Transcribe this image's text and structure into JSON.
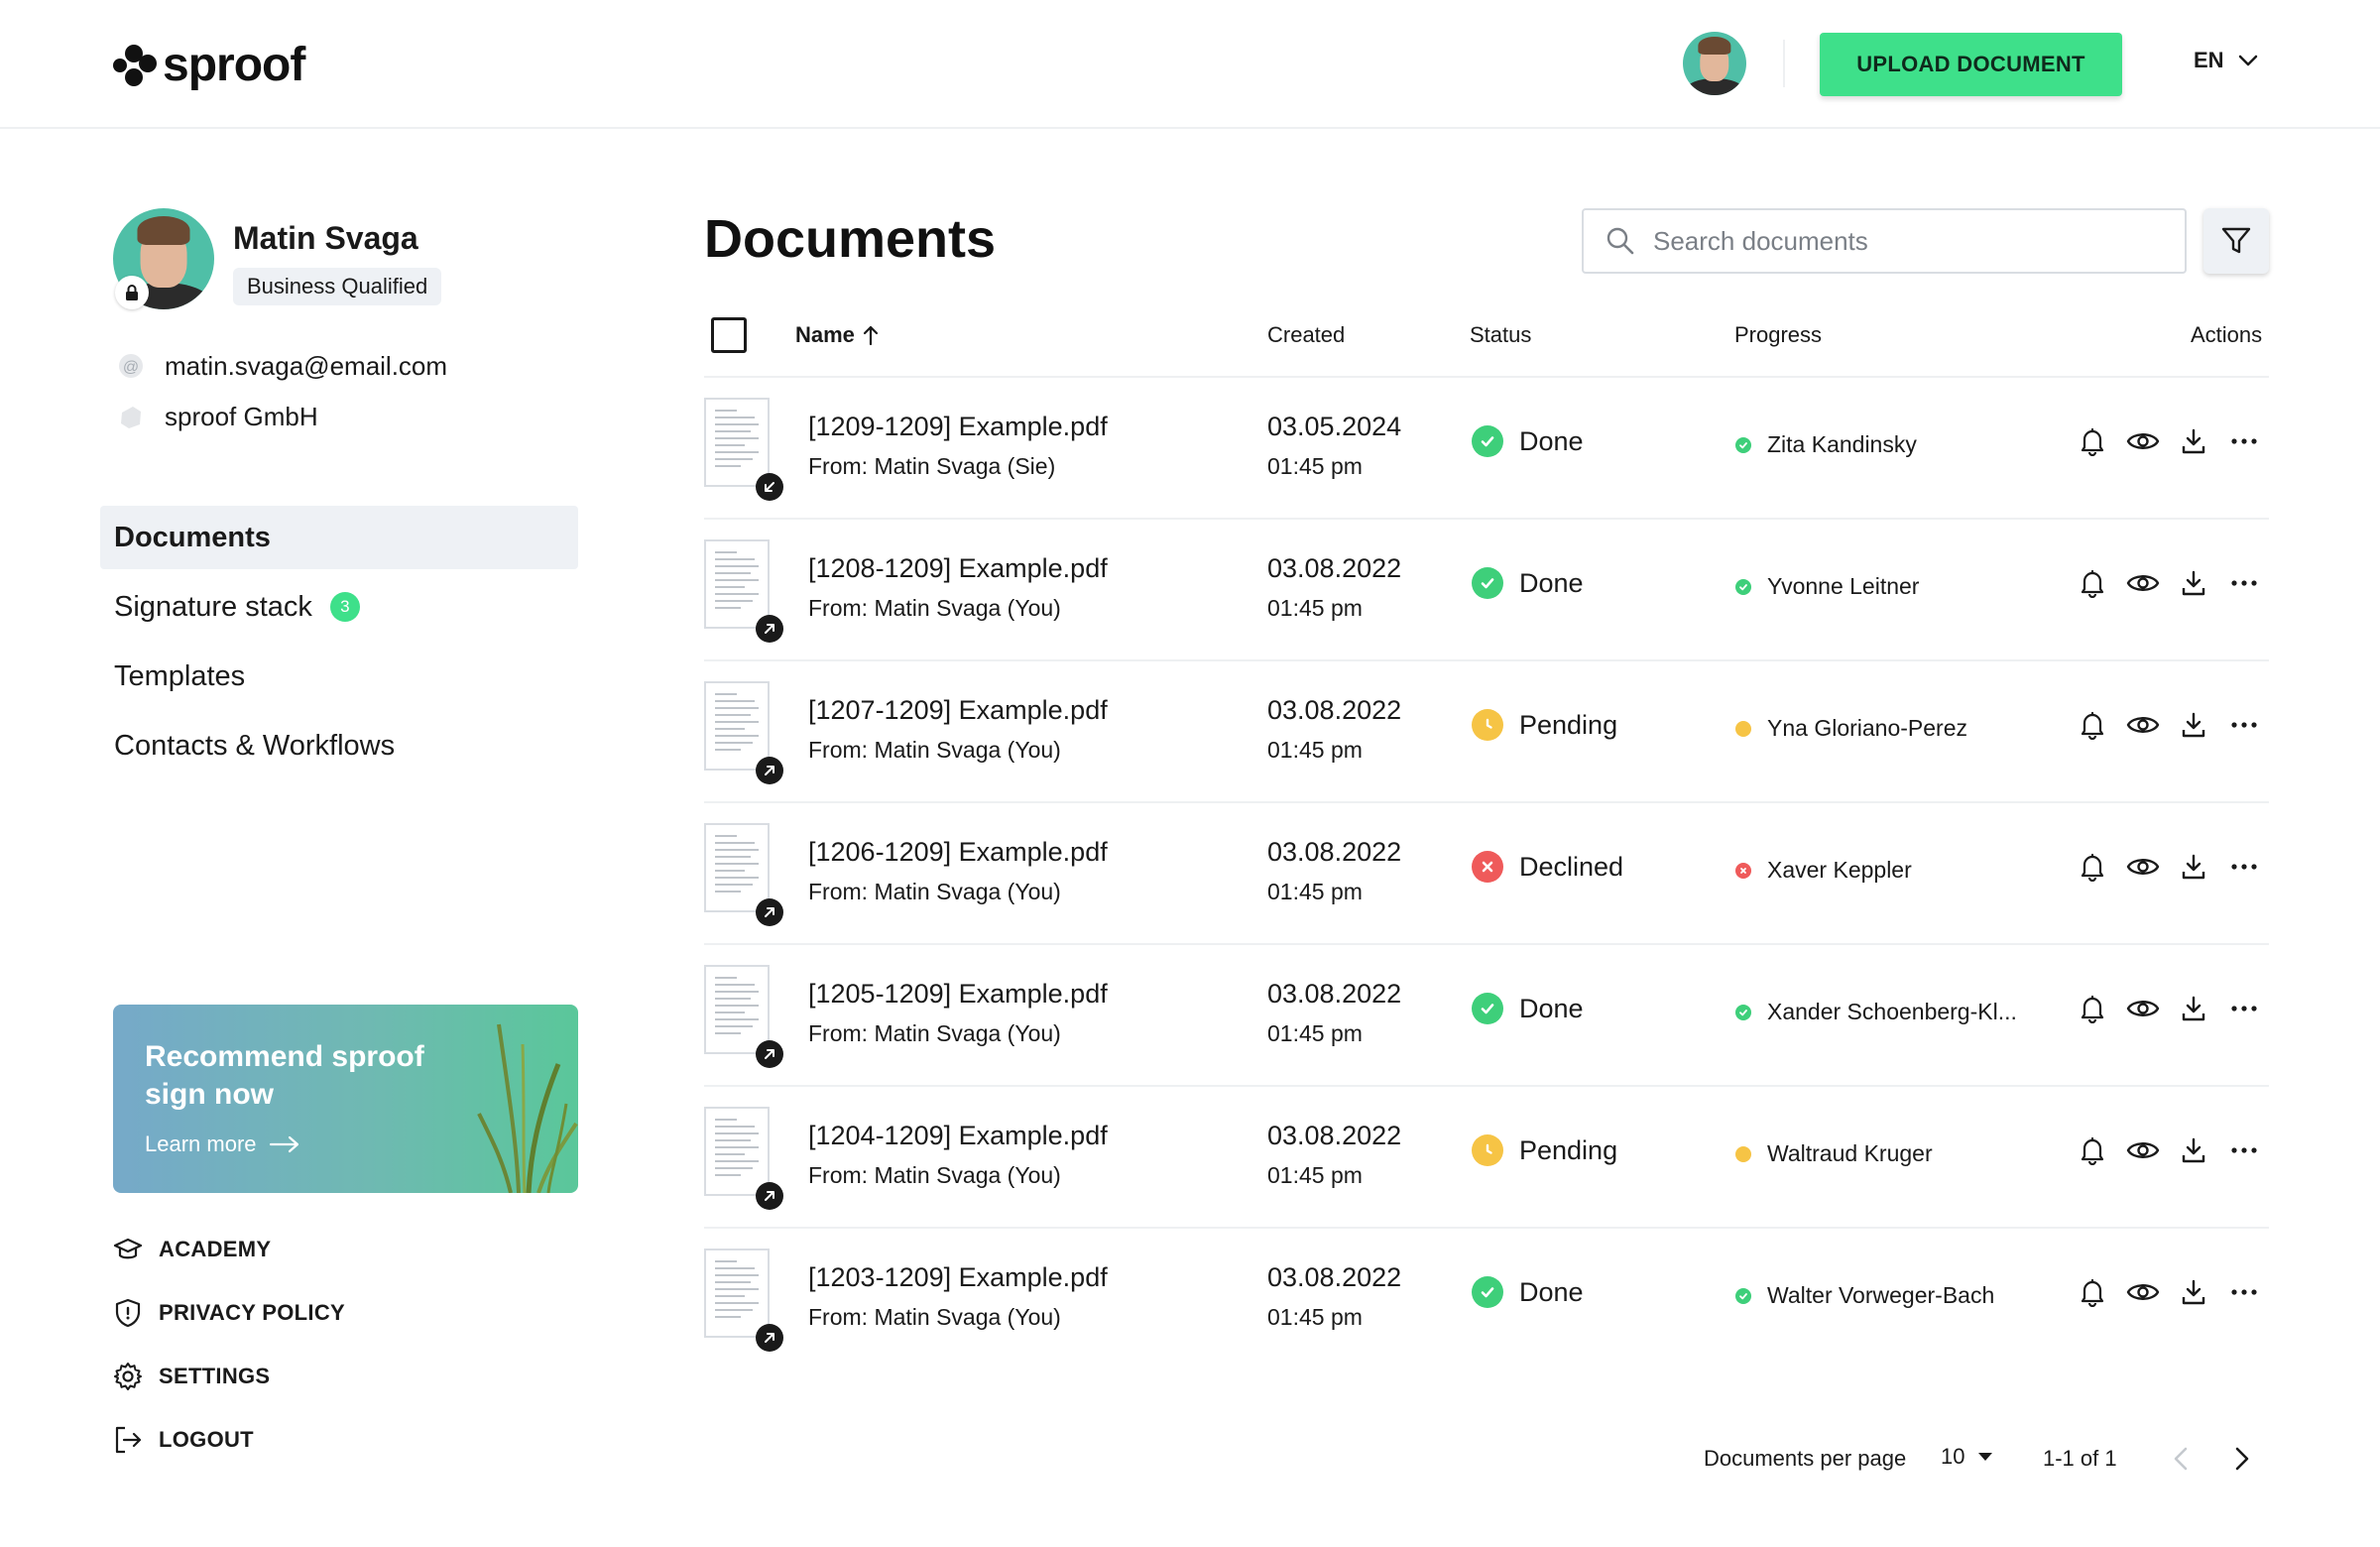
{
  "brand": {
    "name": "sproof",
    "accent": "#3ee08a"
  },
  "header": {
    "upload_label": "UPLOAD DOCUMENT",
    "language": "EN"
  },
  "profile": {
    "name": "Matin Svaga",
    "badge": "Business Qualified",
    "email": "matin.svaga@email.com",
    "company": "sproof GmbH"
  },
  "sidebar": {
    "nav": [
      {
        "label": "Documents",
        "active": true
      },
      {
        "label": "Signature stack",
        "count": "3"
      },
      {
        "label": "Templates"
      },
      {
        "label": "Contacts & Workflows"
      }
    ],
    "promo": {
      "title": "Recommend sproof sign now",
      "link": "Learn more"
    },
    "footer": [
      {
        "label": "ACADEMY",
        "icon": "academy-icon"
      },
      {
        "label": "PRIVACY POLICY",
        "icon": "shield-icon"
      },
      {
        "label": "SETTINGS",
        "icon": "gear-icon"
      },
      {
        "label": "LOGOUT",
        "icon": "logout-icon"
      }
    ]
  },
  "main": {
    "title": "Documents",
    "search_placeholder": "Search documents",
    "columns": {
      "name": "Name",
      "created": "Created",
      "status": "Status",
      "progress": "Progress",
      "actions": "Actions"
    },
    "status_colors": {
      "Done": "#3ecf7a",
      "Pending": "#f6c445",
      "Declined": "#ef5a5a"
    },
    "rows": [
      {
        "name": "[1209-1209] Example.pdf",
        "from": "From: Matin Svaga (Sie)",
        "date": "03.05.2024",
        "time": "01:45 pm",
        "status": "Done",
        "progress": "Zita Kandinsky",
        "direction": "incoming"
      },
      {
        "name": "[1208-1209] Example.pdf",
        "from": "From: Matin Svaga (You)",
        "date": "03.08.2022",
        "time": "01:45 pm",
        "status": "Done",
        "progress": "Yvonne Leitner",
        "direction": "outgoing"
      },
      {
        "name": "[1207-1209] Example.pdf",
        "from": "From: Matin Svaga (You)",
        "date": "03.08.2022",
        "time": "01:45 pm",
        "status": "Pending",
        "progress": "Yna Gloriano-Perez",
        "direction": "outgoing"
      },
      {
        "name": "[1206-1209] Example.pdf",
        "from": "From: Matin Svaga (You)",
        "date": "03.08.2022",
        "time": "01:45 pm",
        "status": "Declined",
        "progress": "Xaver Keppler",
        "direction": "outgoing"
      },
      {
        "name": "[1205-1209] Example.pdf",
        "from": "From: Matin Svaga (You)",
        "date": "03.08.2022",
        "time": "01:45 pm",
        "status": "Done",
        "progress": "Xander Schoenberg-Kl...",
        "direction": "outgoing"
      },
      {
        "name": "[1204-1209] Example.pdf",
        "from": "From: Matin Svaga (You)",
        "date": "03.08.2022",
        "time": "01:45 pm",
        "status": "Pending",
        "progress": "Waltraud Kruger",
        "direction": "outgoing"
      },
      {
        "name": "[1203-1209] Example.pdf",
        "from": "From: Matin Svaga (You)",
        "date": "03.08.2022",
        "time": "01:45 pm",
        "status": "Done",
        "progress": "Walter Vorweger-Bach",
        "direction": "outgoing"
      }
    ],
    "row_actions": [
      "bell-icon",
      "eye-icon",
      "download-icon",
      "more-icon"
    ]
  },
  "pagination": {
    "per_page_label": "Documents per page",
    "per_page": "10",
    "range": "1-1 of 1"
  }
}
